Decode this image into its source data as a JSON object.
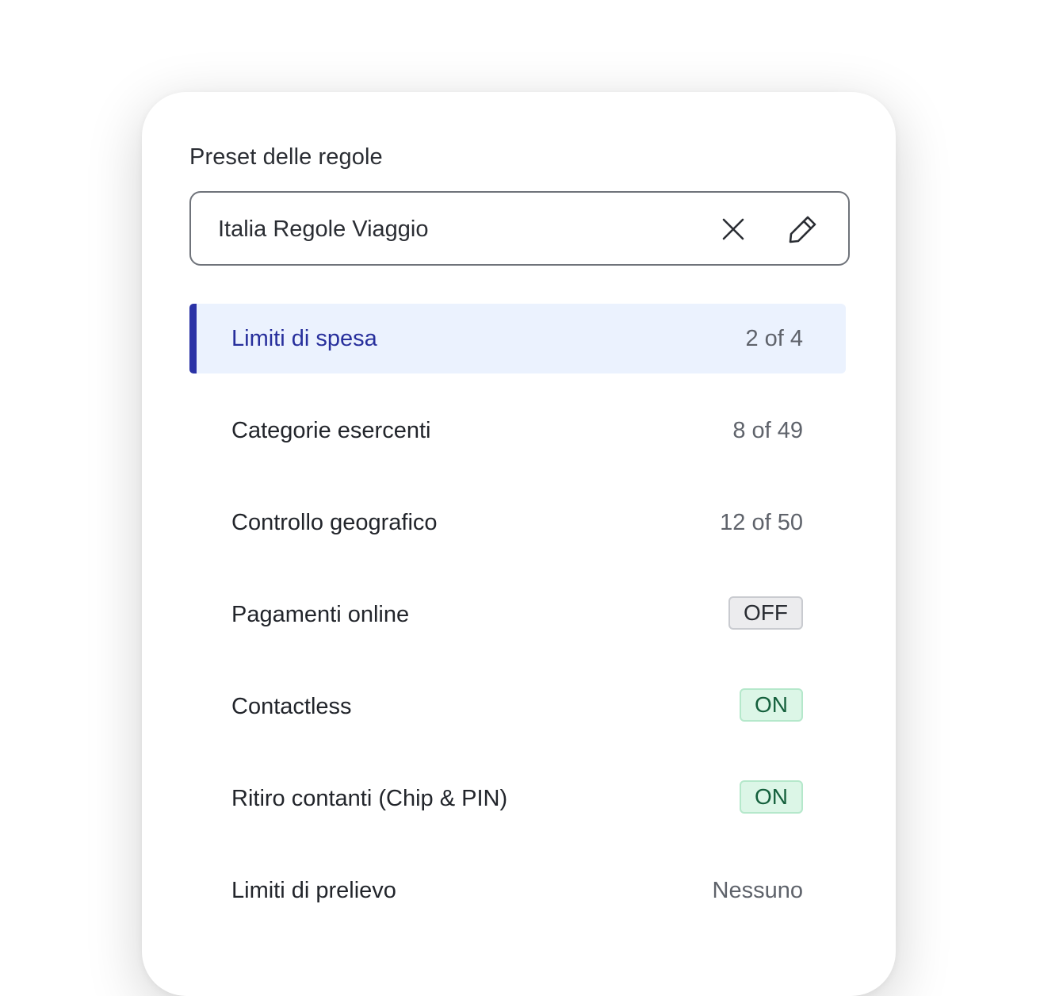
{
  "preset": {
    "section_title": "Preset delle regole",
    "value": "Italia Regole Viaggio",
    "clear_icon": "close-icon",
    "edit_icon": "pencil-icon"
  },
  "rules": [
    {
      "label": "Limiti di spesa",
      "value": "2 of 4",
      "kind": "text",
      "selected": true
    },
    {
      "label": "Categorie esercenti",
      "value": "8 of 49",
      "kind": "text",
      "selected": false
    },
    {
      "label": "Controllo geografico",
      "value": "12 of 50",
      "kind": "text",
      "selected": false
    },
    {
      "label": "Pagamenti online",
      "value": "OFF",
      "kind": "pill-off",
      "selected": false
    },
    {
      "label": "Contactless",
      "value": "ON",
      "kind": "pill-on",
      "selected": false
    },
    {
      "label": "Ritiro contanti (Chip & PIN)",
      "value": "ON",
      "kind": "pill-on",
      "selected": false
    },
    {
      "label": "Limiti di prelievo",
      "value": "Nessuno",
      "kind": "text",
      "selected": false
    }
  ],
  "colors": {
    "accent": "#2a32a6",
    "selected_bg": "#ebf2fe",
    "on_bg": "#dcf6e7",
    "on_text": "#15603d",
    "off_bg": "#ececee"
  }
}
